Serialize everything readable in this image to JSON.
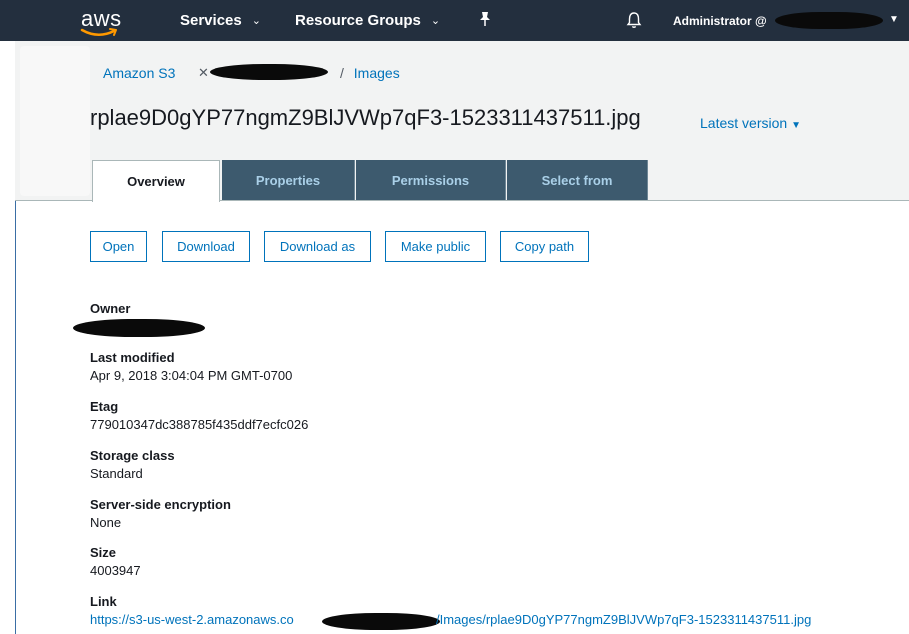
{
  "nav": {
    "logo": "aws",
    "services": "Services",
    "resource_groups": "Resource Groups",
    "caret": "⌄",
    "account": "Administrator @"
  },
  "breadcrumb": {
    "root": "Amazon S3",
    "separator": "/",
    "folder": "Images"
  },
  "object": {
    "filename": "rplae9D0gYP77ngmZ9BlJVWp7qF3-1523311437511.jpg",
    "version": "Latest version"
  },
  "tabs": [
    {
      "label": "Overview",
      "active": true
    },
    {
      "label": "Properties",
      "active": false
    },
    {
      "label": "Permissions",
      "active": false
    },
    {
      "label": "Select from",
      "active": false
    }
  ],
  "actions": {
    "open": "Open",
    "download": "Download",
    "download_as": "Download as",
    "make_public": "Make public",
    "copy_path": "Copy path"
  },
  "properties": {
    "owner_label": "Owner",
    "last_modified_label": "Last modified",
    "last_modified": "Apr 9, 2018 3:04:04 PM GMT-0700",
    "etag_label": "Etag",
    "etag": "779010347dc388785f435ddf7ecfc026",
    "storage_class_label": "Storage class",
    "storage_class": "Standard",
    "encryption_label": "Server-side encryption",
    "encryption": "None",
    "size_label": "Size",
    "size": "4003947",
    "link_label": "Link",
    "link_prefix": "https://s3-us-west-2.amazonaws.co",
    "link_suffix": "/Images/rplae9D0gYP77ngmZ9BlJVWp7qF3-1523311437511.jpg"
  },
  "colors": {
    "nav_bg": "#232f3e",
    "link": "#0073bb",
    "tab_bg": "#3d5a6e",
    "tab_text": "#aad0e8"
  }
}
